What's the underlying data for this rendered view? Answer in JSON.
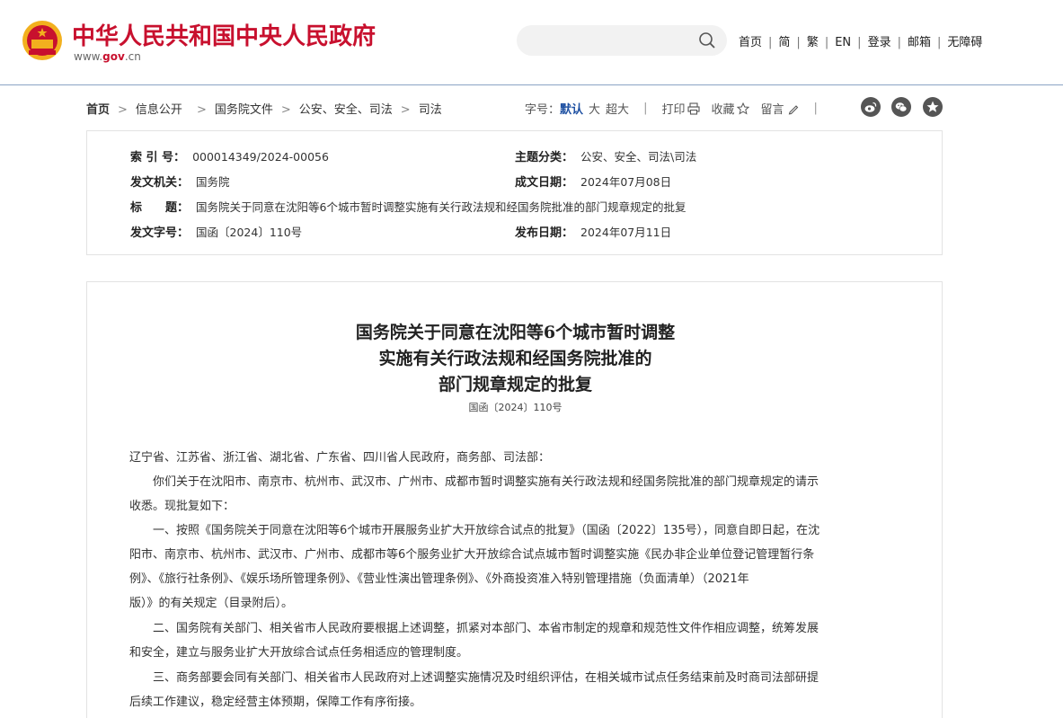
{
  "header": {
    "site_title": "中华人民共和国中央人民政府",
    "site_url_prefix": "www.",
    "site_url_brand": "gov",
    "site_url_suffix": ".cn",
    "search_placeholder": "",
    "nav": [
      "首页",
      "简",
      "繁",
      "EN",
      "登录",
      "邮箱",
      "无障碍"
    ],
    "nav_separator": "|"
  },
  "breadcrumb": {
    "items": [
      "首页",
      "信息公开",
      "国务院文件",
      "公安、安全、司法",
      "司法"
    ],
    "separator": ">"
  },
  "toolbar": {
    "font_size_label": "字号：",
    "font_default": "默认",
    "font_large": "大",
    "font_xlarge": "超大",
    "print": "打印",
    "favorite": "收藏",
    "comment": "留言",
    "bar": "|",
    "share_icons": [
      "weibo-icon",
      "wechat-icon",
      "qzone-icon"
    ]
  },
  "meta": {
    "index_label": "索 引 号：",
    "index_value": "000014349/2024-00056",
    "category_label": "主题分类：",
    "category_value": "公安、安全、司法\\司法",
    "issuer_label": "发文机关：",
    "issuer_value": "国务院",
    "written_label": "成文日期：",
    "written_value": "2024年07月08日",
    "title_label_1": "标",
    "title_label_2": "题：",
    "title_value": "国务院关于同意在沈阳等6个城市暂时调整实施有关行政法规和经国务院批准的部门规章规定的批复",
    "docno_label": "发文字号：",
    "docno_value": "国函〔2024〕110号",
    "published_label": "发布日期：",
    "published_value": "2024年07月11日"
  },
  "article": {
    "title_line_1": "国务院关于同意在沈阳等6个城市暂时调整",
    "title_line_2": "实施有关行政法规和经国务院批准的",
    "title_line_3": "部门规章规定的批复",
    "doc_number": "国函〔2024〕110号",
    "addressee": "辽宁省、江苏省、浙江省、湖北省、广东省、四川省人民政府，商务部、司法部：",
    "p1_l1": "你们关于在沈阳市、南京市、杭州市、武汉市、广州市、成都市暂时调整实施有关行政法规和经国务院批准的部门规章规定的请示",
    "p1_l2": "收悉。现批复如下：",
    "p2_l1": "一、按照《国务院关于同意在沈阳等6个城市开展服务业扩大开放综合试点的批复》（国函〔2022〕135号），同意自即日起，在沈",
    "p2_l2": "阳市、南京市、杭州市、武汉市、广州市、成都市等6个服务业扩大开放综合试点城市暂时调整实施《民办非企业单位登记管理暂行条",
    "p2_l3": "例》、《旅行社条例》、《娱乐场所管理条例》、《营业性演出管理条例》、《外商投资准入特别管理措施（负面清单）（2021年",
    "p2_l4": "版）》的有关规定（目录附后）。",
    "p3_l1": "二、国务院有关部门、相关省市人民政府要根据上述调整，抓紧对本部门、本省市制定的规章和规范性文件作相应调整，统筹发展",
    "p3_l2": "和安全，建立与服务业扩大开放综合试点任务相适应的管理制度。",
    "p4_l1": "三、商务部要会同有关部门、相关省市人民政府对上述调整实施情况及时组织评估，在相关城市试点任务结束前及时商司法部研提",
    "p4_l2": "后续工作建议，稳定经营主体预期，保障工作有序衔接。"
  },
  "colors": {
    "brand_red": "#c8102e",
    "link_blue": "#1e50a2",
    "emblem_gold": "#f2b01e"
  }
}
